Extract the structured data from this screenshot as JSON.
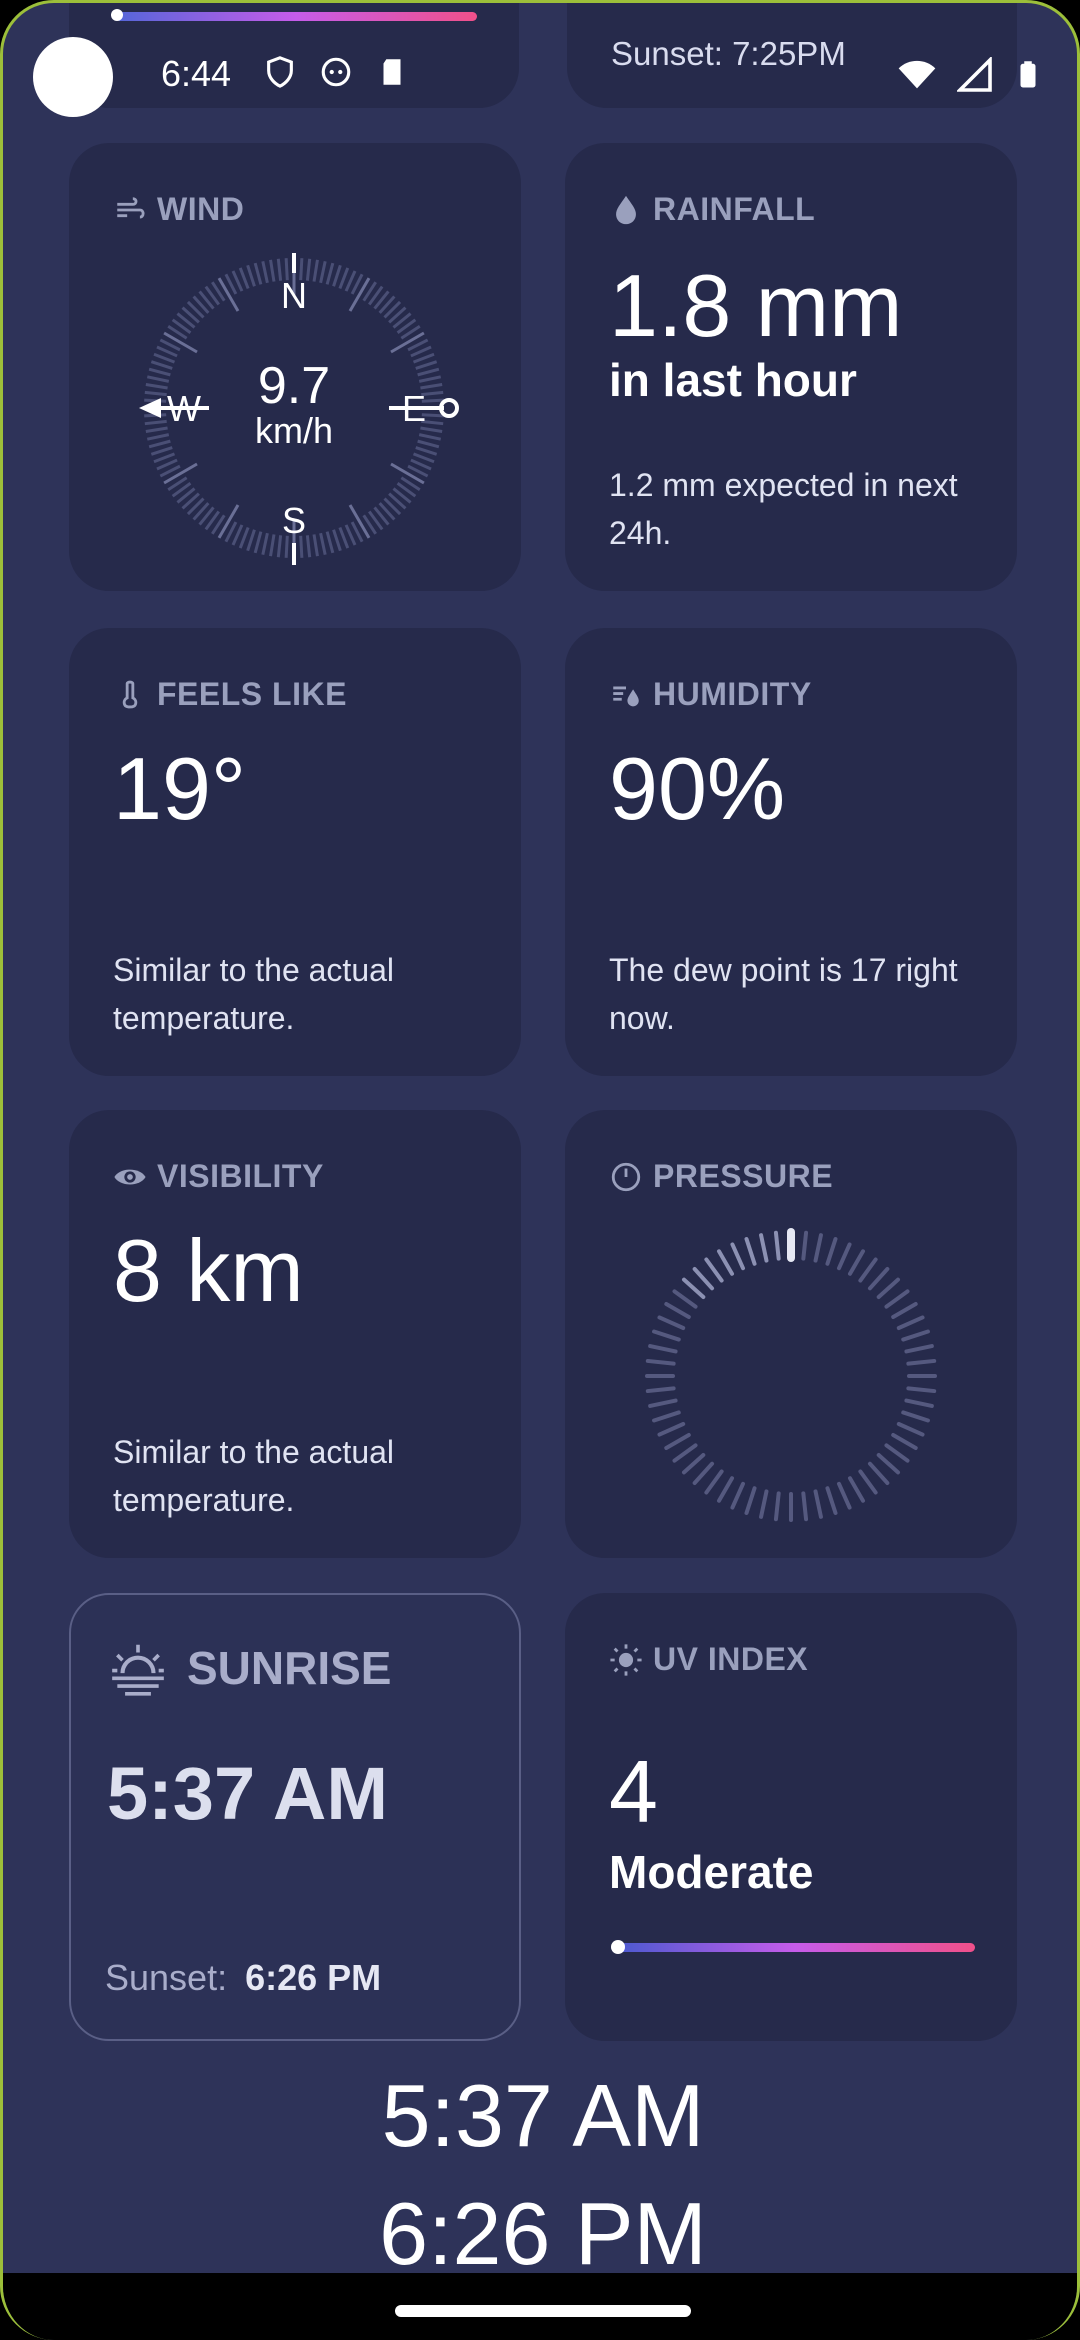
{
  "status": {
    "time": "6:44"
  },
  "top": {
    "sunset_text": "Sunset: 7:25PM"
  },
  "wind": {
    "title": "WIND",
    "speed": "9.7",
    "unit": "km/h",
    "n": "N",
    "s": "S",
    "w": "W",
    "e": "E"
  },
  "rainfall": {
    "title": "RAINFALL",
    "value": "1.8 mm",
    "period": "in last hour",
    "desc": "1.2 mm expected in next 24h."
  },
  "feels_like": {
    "title": "FEELS LIKE",
    "value": "19°",
    "desc": "Similar to the actual temperature."
  },
  "humidity": {
    "title": "HUMIDITY",
    "value": "90%",
    "desc": "The dew point is 17 right now."
  },
  "visibility": {
    "title": "VISIBILITY",
    "value": "8 km",
    "desc": "Similar to the actual temperature."
  },
  "pressure": {
    "title": "PRESSURE"
  },
  "sunrise": {
    "title": "SUNRISE",
    "time": "5:37 AM",
    "sunset_label": "Sunset:",
    "sunset_time": "6:26 PM"
  },
  "uv": {
    "title": "UV INDEX",
    "value": "4",
    "level": "Moderate",
    "level_fraction": 0.0
  },
  "bottom": {
    "line1": "5:37 AM",
    "line2": "6:26 PM"
  },
  "colors": {
    "background": "#2e3359",
    "card": "#262a4b",
    "label": "#9aa0bd",
    "gradient": [
      "#5466d8",
      "#c65cea",
      "#f0508a"
    ]
  }
}
